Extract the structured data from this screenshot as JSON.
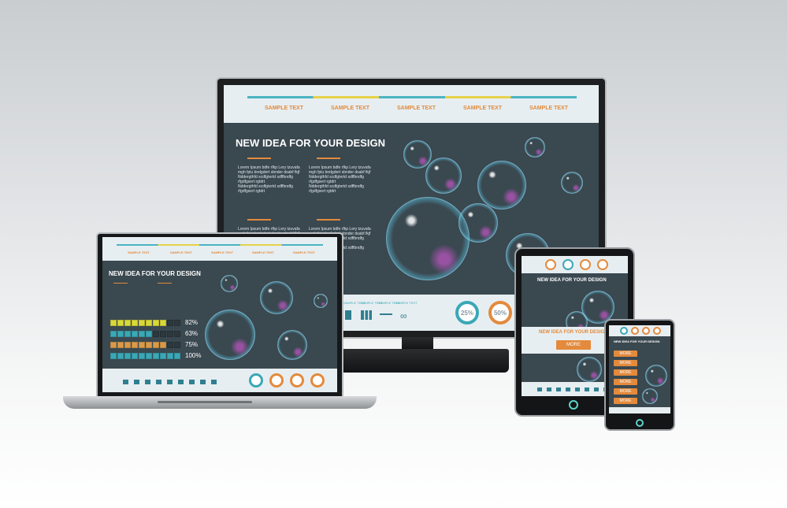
{
  "desktop": {
    "nav": [
      "SAMPLE TEXT",
      "SAMPLE TEXT",
      "SAMPLE TEXT",
      "SAMPLE TEXT",
      "SAMPLE TEXT"
    ],
    "title": "NEW IDEA FOR YOUR DESIGN",
    "lorem": "Lorem Ipsum bdfe rfkp Lery tzuvafa\nmgh fpiu bndgdert sbnder dsabf fkjf\nNddergthfd scdfgtertd sdffbndfg\nrfgdfgsert rgtdrt\nNddergthfd scdfgtertd sdffbndfg\nrfgdfgsert rgtdrt",
    "bottom_labels": [
      "SAMPLE TEXT",
      "SAMPLE TEXT",
      "SAMPLE TEXT",
      "SAMPLE TEXT"
    ],
    "donuts": [
      "25%",
      "50%"
    ]
  },
  "laptop": {
    "nav": [
      "SAMPLE TEXT",
      "SAMPLE TEXT",
      "SAMPLE TEXT",
      "SAMPLE TEXT",
      "SAMPLE TEXT"
    ],
    "title": "NEW IDEA FOR YOUR DESIGN",
    "progress": [
      {
        "label": "82%",
        "value": 82,
        "color": "#d8d83a"
      },
      {
        "label": "63%",
        "value": 63,
        "color": "#3aa8b6"
      },
      {
        "label": "75%",
        "value": 75,
        "color": "#d89a4a"
      },
      {
        "label": "100%",
        "value": 100,
        "color": "#3aa8b6"
      }
    ]
  },
  "tablet": {
    "title": "NEW IDEA FOR YOUR DESIGN",
    "more_label": "MORE"
  },
  "phone": {
    "title": "NEW IDEA FOR YOUR DESIGN",
    "buttons": [
      "MORE",
      "MORE",
      "MORE",
      "MORE",
      "MORE",
      "MORE"
    ]
  },
  "colors": {
    "accent": "#e38a3c",
    "teal": "#3aa8b6",
    "screen": "#3a4850",
    "header": "#e7eef1"
  }
}
